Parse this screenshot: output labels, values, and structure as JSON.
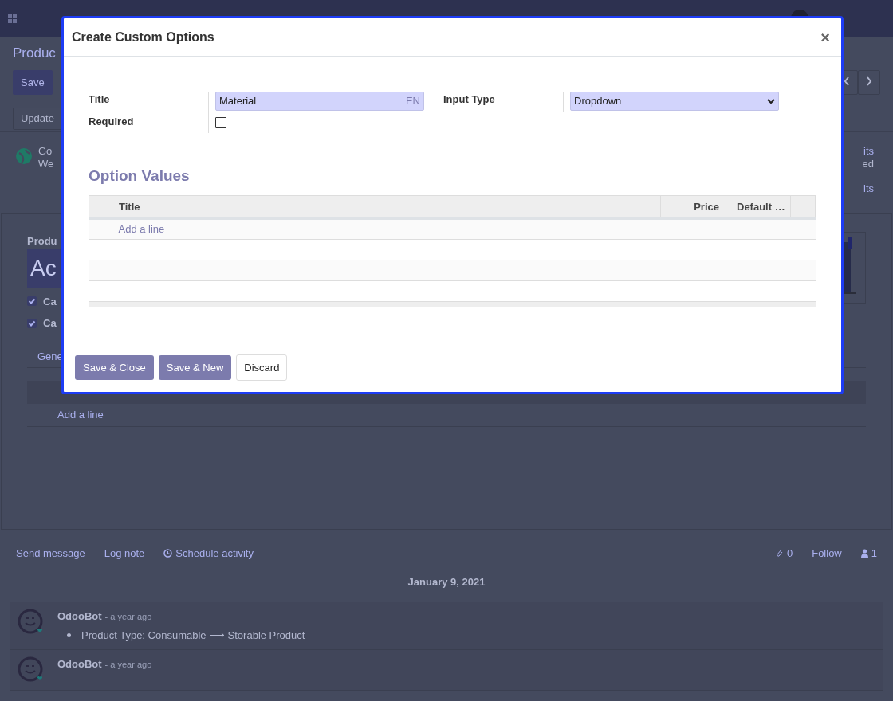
{
  "control_panel": {
    "breadcrumb": "Produc",
    "save_button": "Save",
    "update_button": "Update",
    "smart_button": [
      "Go",
      "We"
    ],
    "stat_fragments": [
      "its",
      "ed",
      "its"
    ]
  },
  "form": {
    "name_label": "Produ",
    "name_value": "Ac",
    "checkboxes": [
      {
        "label": "Ca",
        "checked": true
      },
      {
        "label": "Ca",
        "checked": true
      }
    ],
    "tab": "Gene",
    "add_line": "Add a line"
  },
  "modal": {
    "title": "Create Custom Options",
    "close": "×",
    "fields": {
      "title_label": "Title",
      "title_value": "Material",
      "language": "EN",
      "required_label": "Required",
      "required": false,
      "input_type_label": "Input Type",
      "input_type_value": "Dropdown"
    },
    "section": "Option Values",
    "columns": [
      "Title",
      "Price",
      "Default …"
    ],
    "add_line": "Add a line",
    "buttons": [
      {
        "label": "Save & Close",
        "kind": "primary"
      },
      {
        "label": "Save & New",
        "kind": "primary"
      },
      {
        "label": "Discard",
        "kind": "secondary"
      }
    ]
  },
  "chatter": {
    "actions": [
      "Send message",
      "Log note",
      "Schedule activity"
    ],
    "attachments": "0",
    "follow": "Follow",
    "followers": "1",
    "date": "January 9, 2021",
    "messages": [
      {
        "author": "OdooBot",
        "time": "- a year ago",
        "changes": [
          {
            "old": "Product Type: Consumable",
            "arrow": "⟶",
            "new": "Storable Product"
          }
        ]
      },
      {
        "author": "OdooBot",
        "time": "- a year ago"
      }
    ]
  }
}
